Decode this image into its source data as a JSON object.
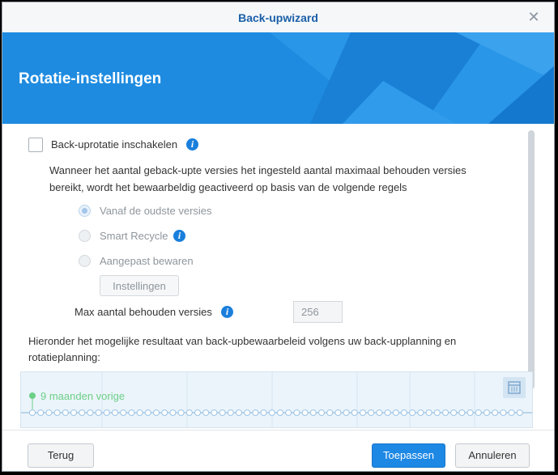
{
  "window": {
    "title": "Back-upwizard",
    "close_symbol": "✕"
  },
  "banner": {
    "title": "Rotatie-instellingen",
    "color": "#1e8be0"
  },
  "rotation": {
    "enable_label": "Back-uprotatie inschakelen",
    "enabled": false,
    "description": "Wanneer het aantal geback-upte versies het ingesteld aantal maximaal behouden versies bereikt, wordt het bewaarbeldig geactiveerd op basis van de volgende regels",
    "options": [
      {
        "label": "Vanaf de oudste versies",
        "selected": true
      },
      {
        "label": "Smart Recycle",
        "selected": false,
        "info": true
      },
      {
        "label": "Aangepast bewaren",
        "selected": false
      }
    ],
    "settings_button": "Instellingen",
    "max_versions_label": "Max aantal behouden versies",
    "max_versions_value": "256"
  },
  "preview": {
    "text": "Hieronder het mogelijke resultaat van back-upbewaarbeleid volgens uw back-upplanning en rotatieplanning:",
    "marker_label": "9 maanden vorige",
    "accent": "#6ccf86"
  },
  "footer": {
    "back": "Terug",
    "apply": "Toepassen",
    "cancel": "Annuleren"
  }
}
